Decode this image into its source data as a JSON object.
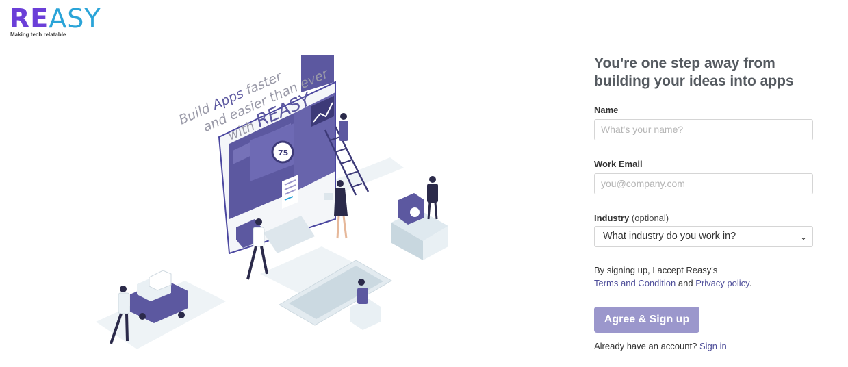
{
  "brand": {
    "logo_re": "RE",
    "logo_asy": "ASY",
    "tagline": "Making tech relatable"
  },
  "illustration": {
    "line1_pre": "Build ",
    "line1_apps": "Apps",
    "line1_post": " faster",
    "line2": "and easier than ever",
    "line3_pre": "with ",
    "line3_brand": "REASY",
    "badge": "75"
  },
  "form": {
    "heading_line1": "You're one step away from",
    "heading_line2": "building your ideas into apps",
    "name_label": "Name",
    "name_placeholder": "What's your name?",
    "email_label": "Work Email",
    "email_placeholder": "you@company.com",
    "industry_label": "Industry",
    "industry_optional": "(optional)",
    "industry_selected": "What industry do you work in?",
    "terms_prefix": "By signing up, I accept Reasy's",
    "terms_link": "Terms and Condition",
    "terms_and": "and",
    "privacy_link": "Privacy policy",
    "terms_period": ".",
    "submit_label": "Agree & Sign up",
    "signin_prefix": "Already have an account?",
    "signin_link": "Sign in"
  },
  "colors": {
    "brand_purple": "#6b3fd8",
    "brand_blue": "#2aa4d8",
    "illustration_purple": "#5c58a0",
    "button": "#9b97cc",
    "link": "#4d4d99"
  }
}
